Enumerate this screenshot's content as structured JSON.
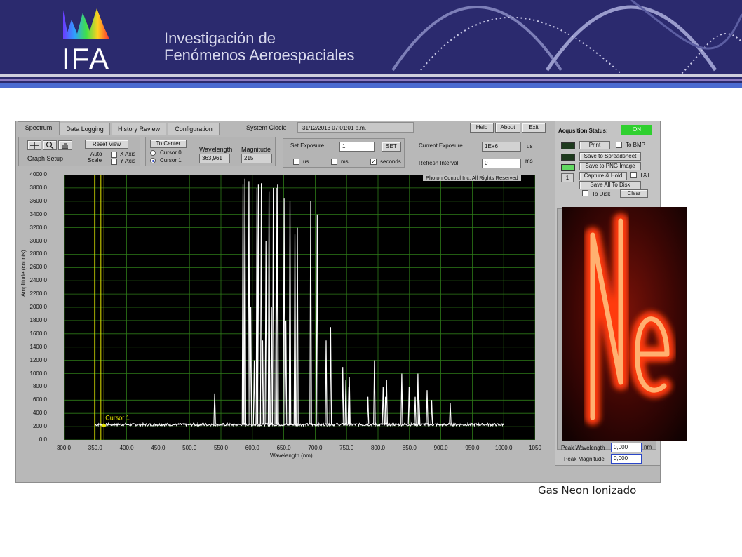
{
  "banner": {
    "logo_text": "IFA",
    "org_line1": "Investigación de",
    "org_line2": "Fenómenos Aeroespaciales"
  },
  "window": {
    "tabs": [
      "Spectrum",
      "Data Logging",
      "History Review",
      "Configuration"
    ],
    "active_tab": "Spectrum",
    "system_clock_label": "System Clock:",
    "system_clock_value": "31/12/2013 07:01:01 p.m.",
    "buttons": {
      "help": "Help",
      "about": "About",
      "exit": "Exit"
    }
  },
  "graph_setup": {
    "label": "Graph Setup",
    "reset_view": "Reset View",
    "autoscale_label_1": "Auto",
    "autoscale_label_2": "Scale",
    "x_axis": "X Axis",
    "y_axis": "Y Axis",
    "icons": [
      "crosshair-icon",
      "zoom-icon",
      "pan-hand-icon"
    ]
  },
  "cursor": {
    "to_center": "To Center",
    "cursor0": "Cursor 0",
    "cursor1": "Cursor 1",
    "selected": "Cursor 1",
    "wavelength_label": "Wavelength",
    "wavelength_value": "363,961",
    "magnitude_label": "Magnitude",
    "magnitude_value": "215"
  },
  "exposure": {
    "set_label": "Set Exposure",
    "set_value": "1",
    "set_button": "SET",
    "units": [
      "us",
      "ms",
      "seconds"
    ],
    "selected_unit": "seconds",
    "current_label": "Current Exposure",
    "current_value": "1E+6",
    "current_unit": "us",
    "refresh_label": "Refresh Interval:",
    "refresh_value": "0",
    "refresh_unit": "ms"
  },
  "acquisition": {
    "status_label": "Acqusition Status:",
    "status_value": "ON",
    "status_color": "#2fd02f",
    "print": "Print",
    "to_bmp": "To BMP",
    "save_spreadsheet": "Save to Spreadsheet",
    "save_png": "Save to PNG Image",
    "capture_hold": "Capture & Hold",
    "txt": "TXT",
    "save_all": "Save All To Disk",
    "to_disk": "To Disk",
    "clear": "Clear",
    "counter": "1",
    "peak_wavelength_label": "Peak Wavelength",
    "peak_wavelength_value": "0,000",
    "peak_wavelength_unit": "nm",
    "peak_magnitude_label": "Peak Magnitude",
    "peak_magnitude_value": "0,000"
  },
  "caption": "Gas Neon Ionizado",
  "chart_data": {
    "type": "line",
    "watermark": "Photon Control Inc. All Rights Reserved",
    "xlabel": "Wavelength (nm)",
    "ylabel": "Amplitude (counts)",
    "xlim": [
      300,
      1050
    ],
    "ylim": [
      0,
      4000
    ],
    "xticks": [
      "300,0",
      "350,0",
      "400,0",
      "450,0",
      "500,0",
      "550,0",
      "600,0",
      "650,0",
      "700,0",
      "750,0",
      "800,0",
      "850,0",
      "900,0",
      "950,0",
      "1000,0",
      "1050"
    ],
    "yticks": [
      "0,0",
      "200,0",
      "400,0",
      "600,0",
      "800,0",
      "1000,0",
      "1200,0",
      "1400,0",
      "1600,0",
      "1800,0",
      "2000,0",
      "2200,0",
      "2400,0",
      "2600,0",
      "2800,0",
      "3000,0",
      "3200,0",
      "3400,0",
      "3600,0",
      "3800,0",
      "4000,0"
    ],
    "grid": true,
    "background": "#000000",
    "grid_color": "#2e7a18",
    "line_color": "#ffffff",
    "baseline": 230,
    "range": [
      350,
      1000
    ],
    "cursor_label": "Cursor 1",
    "cursor_x": 363.961,
    "cursor_y": 215,
    "cursor_color": "#e6e600",
    "peaks": [
      [
        540.1,
        700
      ],
      [
        585.2,
        3850
      ],
      [
        588.2,
        3940
      ],
      [
        594.5,
        3900
      ],
      [
        597.6,
        2000
      ],
      [
        603.0,
        1200
      ],
      [
        607.4,
        3800
      ],
      [
        609.6,
        3850
      ],
      [
        614.3,
        3870
      ],
      [
        616.4,
        1500
      ],
      [
        621.7,
        3000
      ],
      [
        626.6,
        3750
      ],
      [
        630.5,
        2000
      ],
      [
        633.4,
        3800
      ],
      [
        638.3,
        3800
      ],
      [
        640.2,
        3850
      ],
      [
        650.6,
        3650
      ],
      [
        653.3,
        1800
      ],
      [
        659.9,
        3600
      ],
      [
        667.8,
        3100
      ],
      [
        671.7,
        3200
      ],
      [
        692.9,
        3600
      ],
      [
        703.2,
        3400
      ],
      [
        717.4,
        1500
      ],
      [
        724.5,
        1700
      ],
      [
        743.9,
        1100
      ],
      [
        748.9,
        900
      ],
      [
        753.6,
        800
      ],
      [
        754.4,
        950
      ],
      [
        783.9,
        650
      ],
      [
        794.3,
        1200
      ],
      [
        808.2,
        800
      ],
      [
        811.9,
        650
      ],
      [
        813.6,
        900
      ],
      [
        837.8,
        1000
      ],
      [
        849.5,
        800
      ],
      [
        859.1,
        650
      ],
      [
        863.5,
        1000
      ],
      [
        865.4,
        600
      ],
      [
        878.1,
        750
      ],
      [
        885.4,
        600
      ],
      [
        914.9,
        550
      ]
    ]
  }
}
